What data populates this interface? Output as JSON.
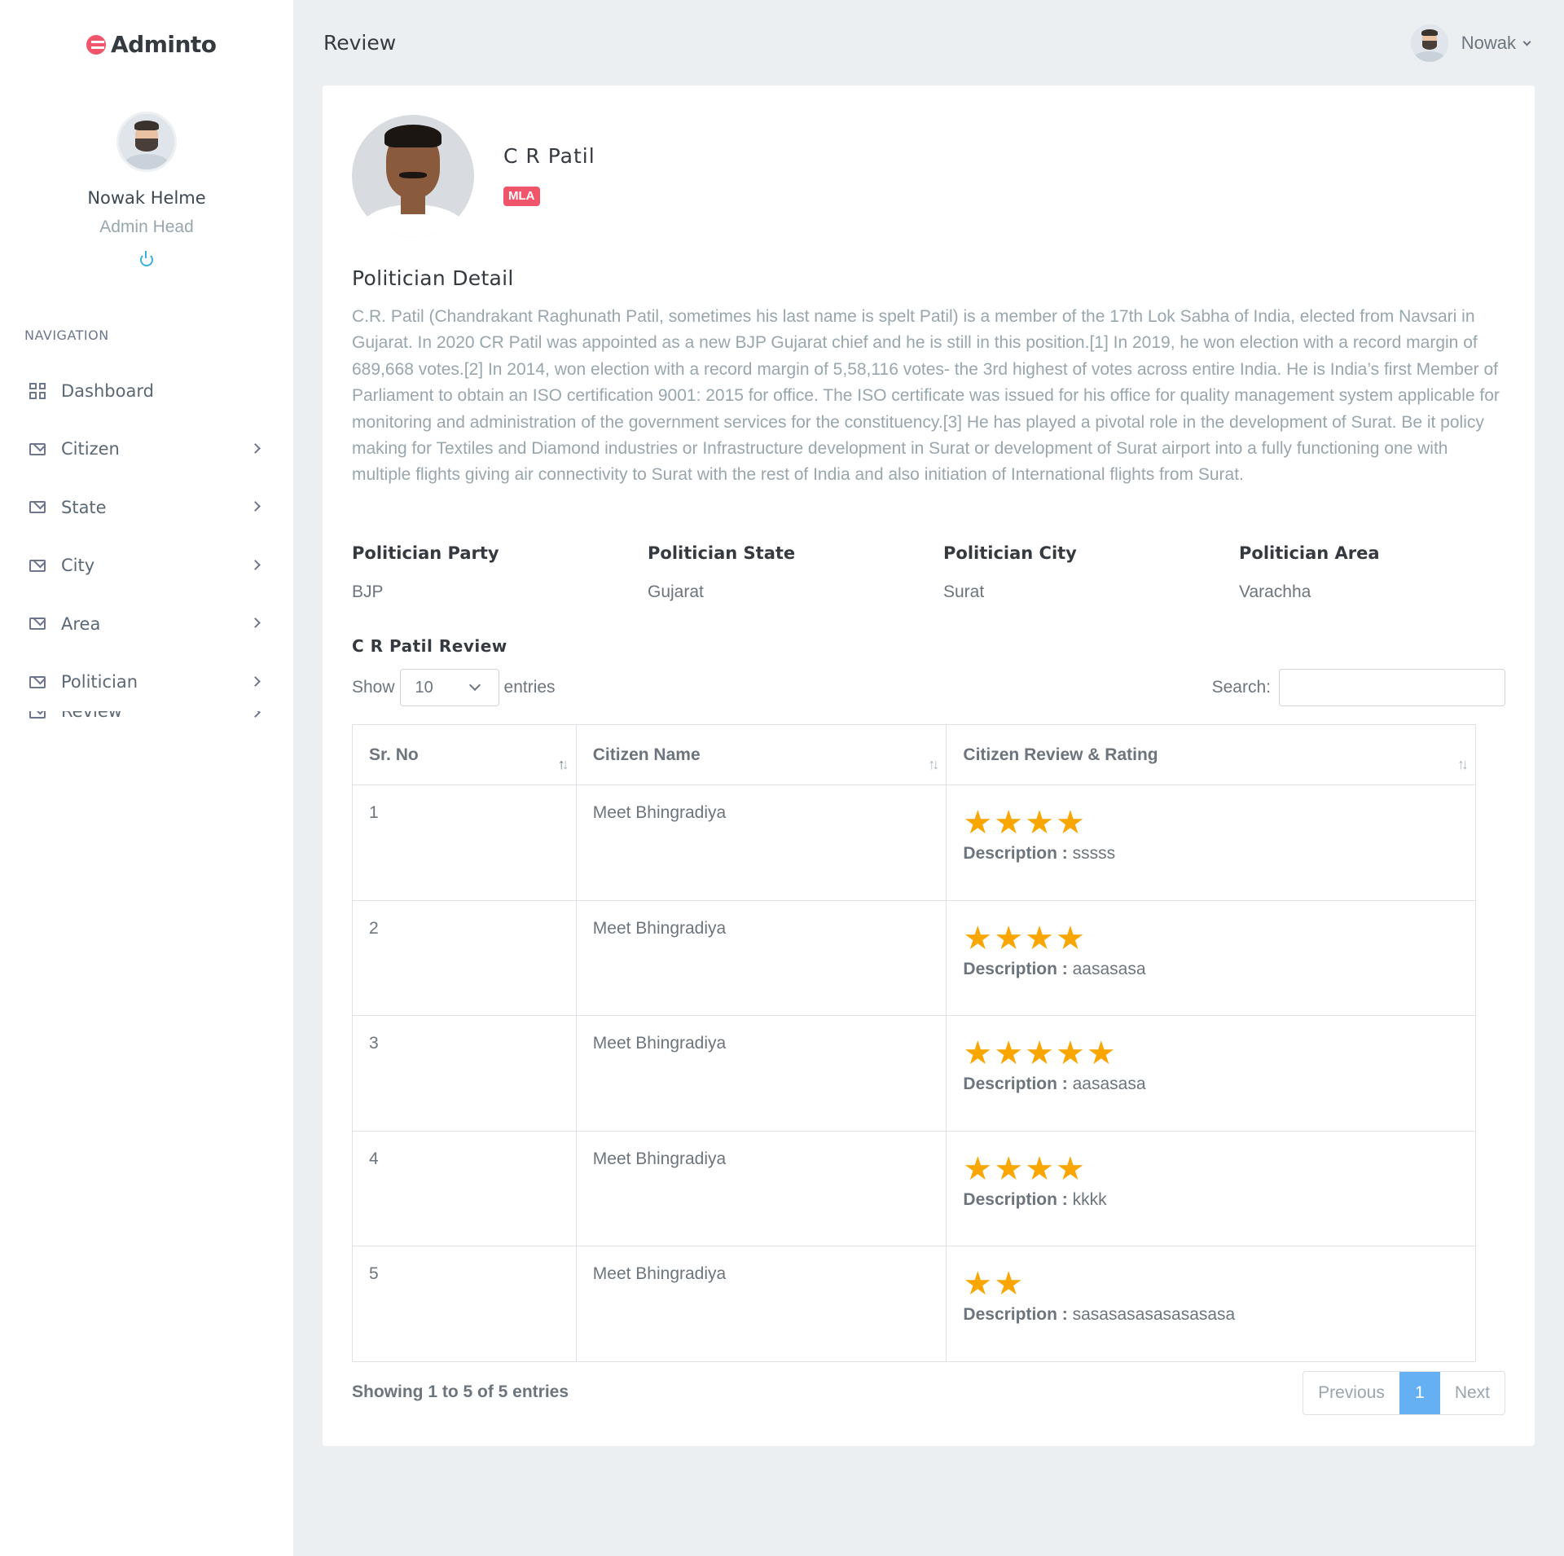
{
  "app": {
    "name": "Adminto"
  },
  "sidebar": {
    "user": {
      "name": "Nowak Helme",
      "role": "Admin Head"
    },
    "nav_title": "NAVIGATION",
    "items": [
      {
        "label": "Dashboard",
        "icon": "dashboard-icon"
      },
      {
        "label": "Citizen",
        "icon": "mail-icon"
      },
      {
        "label": "State",
        "icon": "mail-icon"
      },
      {
        "label": "City",
        "icon": "mail-icon"
      },
      {
        "label": "Area",
        "icon": "mail-icon"
      },
      {
        "label": "Politician",
        "icon": "mail-icon"
      },
      {
        "label": "Review",
        "icon": "mail-icon"
      }
    ]
  },
  "topbar": {
    "page_title": "Review",
    "user_name": "Nowak"
  },
  "politician": {
    "name": "C R Patil",
    "badge": "MLA",
    "section_title": "Politician Detail",
    "description": "C.R. Patil (Chandrakant Raghunath Patil, sometimes his last name is spelt Patil) is a member of the 17th Lok Sabha of India, elected from Navsari in Gujarat. In 2020 CR Patil was appointed as a new BJP Gujarat chief and he is still in this position.[1] In 2019, he won election with a record margin of 689,668 votes.[2] In 2014, won election with a record margin of 5,58,116 votes- the 3rd highest of votes across entire India. He is India’s first Member of Parliament to obtain an ISO certification 9001: 2015 for office. The ISO certificate was issued for his office for quality management system applicable for monitoring and administration of the government services for the constituency.[3] He has played a pivotal role in the development of Surat. Be it policy making for Textiles and Diamond industries or Infrastructure development in Surat or development of Surat airport into a fully functioning one with multiple flights giving air connectivity to Surat with the rest of India and also initiation of International flights from Surat.",
    "details": [
      {
        "label": "Politician Party",
        "value": "BJP"
      },
      {
        "label": "Politician State",
        "value": "Gujarat"
      },
      {
        "label": "Politician City",
        "value": "Surat"
      },
      {
        "label": "Politician Area",
        "value": "Varachha"
      }
    ]
  },
  "reviews": {
    "title": "C R Patil Review",
    "show_label": "Show",
    "entries_label": "entries",
    "page_size": "10",
    "search_label": "Search:",
    "columns": [
      "Sr. No",
      "Citizen Name",
      "Citizen Review & Rating"
    ],
    "description_label": "Description :",
    "rows": [
      {
        "sr": "1",
        "citizen": "Meet Bhingradiya",
        "rating": 4,
        "description": "sssss"
      },
      {
        "sr": "2",
        "citizen": "Meet Bhingradiya",
        "rating": 4,
        "description": "aasasasa"
      },
      {
        "sr": "3",
        "citizen": "Meet Bhingradiya",
        "rating": 5,
        "description": "aasasasa"
      },
      {
        "sr": "4",
        "citizen": "Meet Bhingradiya",
        "rating": 4,
        "description": "kkkk"
      },
      {
        "sr": "5",
        "citizen": "Meet Bhingradiya",
        "rating": 2,
        "description": "sasasasasasasasasa"
      }
    ],
    "info": "Showing 1 to 5 of 5 entries",
    "pagination": {
      "previous": "Previous",
      "current": "1",
      "next": "Next"
    }
  },
  "colors": {
    "accent": "#64b0f2",
    "badge": "#f1556c",
    "star": "#f9a600",
    "logo": "#f1556c"
  }
}
